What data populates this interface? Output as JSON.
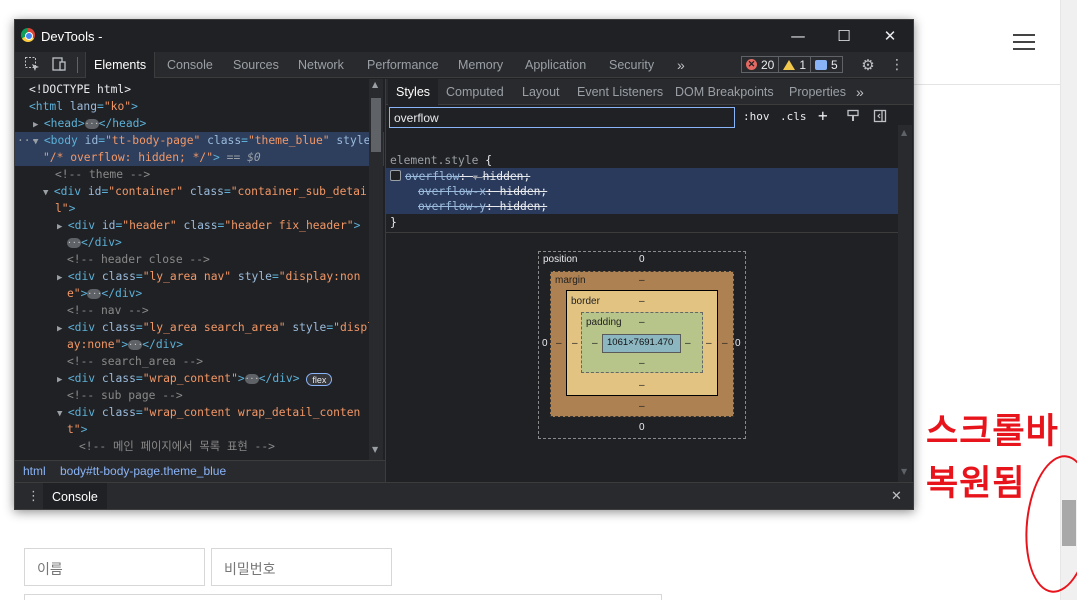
{
  "background_page": {
    "form": {
      "name_placeholder": "이름",
      "password_placeholder": "비밀번호"
    },
    "annotation": {
      "line1": "스크롤바",
      "line2": "복원됨",
      "color": "#e8141c"
    }
  },
  "devtools": {
    "window_title": "DevTools -",
    "window_buttons": {
      "minimize": "—",
      "maximize": "☐",
      "close": "✕"
    },
    "main_tabs": [
      "Elements",
      "Console",
      "Sources",
      "Network",
      "Performance",
      "Memory",
      "Application",
      "Security"
    ],
    "more_tabs": "»",
    "counts": {
      "errors": "20",
      "warnings": "1",
      "messages": "5"
    },
    "elements": {
      "lines": [
        {
          "indent": 0,
          "text": "<!DOCTYPE html>"
        },
        {
          "indent": 0,
          "text": "<html lang=\"ko\">"
        },
        {
          "indent": 1,
          "text": "<head>…</head>"
        },
        {
          "indent": 1,
          "text": "<body id=\"tt-body-page\" class=\"theme_blue\" style="
        },
        {
          "indent": 1,
          "text": "\"/* overflow: hidden; */\"> == $0"
        },
        {
          "indent": 2,
          "text": "<!-- theme -->"
        },
        {
          "indent": 2,
          "text": "<div id=\"container\" class=\"container_sub_detai"
        },
        {
          "indent": 2,
          "text": "l\">"
        },
        {
          "indent": 3,
          "text": "<div id=\"header\" class=\"header fix_header\">"
        },
        {
          "indent": 3,
          "text": "…</div>"
        },
        {
          "indent": 3,
          "text": "<!-- header close -->"
        },
        {
          "indent": 3,
          "text": "<div class=\"ly_area nav\" style=\"display:non"
        },
        {
          "indent": 3,
          "text": "e\">…</div>"
        },
        {
          "indent": 3,
          "text": "<!-- nav -->"
        },
        {
          "indent": 3,
          "text": "<div class=\"ly_area search_area\" style=\"displ"
        },
        {
          "indent": 3,
          "text": "ay:none\">…</div>"
        },
        {
          "indent": 3,
          "text": "<!-- search_area -->"
        },
        {
          "indent": 3,
          "text": "<div class=\"wrap_content\">…</div> flex"
        },
        {
          "indent": 3,
          "text": "<!-- sub page -->"
        },
        {
          "indent": 3,
          "text": "<div class=\"wrap_content wrap_detail_conten"
        },
        {
          "indent": 3,
          "text": "t\">"
        },
        {
          "indent": 4,
          "text": "<!-- 메인 페이지에서 목록 표현 -->"
        }
      ],
      "selected_marker": "== $0",
      "flex_badge": "flex"
    },
    "breadcrumbs": {
      "first": "html",
      "second_tag": "body",
      "second_rest": "#tt-body-page.theme_blue"
    },
    "side_tabs": [
      "Styles",
      "Computed",
      "Layout",
      "Event Listeners",
      "DOM Breakpoints",
      "Properties"
    ],
    "styles": {
      "filter_value": "overflow",
      "hov": ":hov",
      "cls": ".cls",
      "selector": "element.style",
      "open_brace": "{",
      "close_brace": "}",
      "declarations": [
        {
          "prop": "overflow",
          "value": "hidden;"
        },
        {
          "prop": "overflow-x",
          "value": "hidden;"
        },
        {
          "prop": "overflow-y",
          "value": "hidden;"
        }
      ]
    },
    "box_model": {
      "position_label": "position",
      "margin_label": "margin",
      "border_label": "border",
      "padding_label": "padding",
      "content": "1061×7691.470",
      "position_top": "0",
      "position_bottom": "0",
      "position_left": "0",
      "position_right": "0",
      "dash": "–"
    },
    "drawer": {
      "tab": "Console",
      "close": "✕",
      "menu": "⋮"
    }
  }
}
